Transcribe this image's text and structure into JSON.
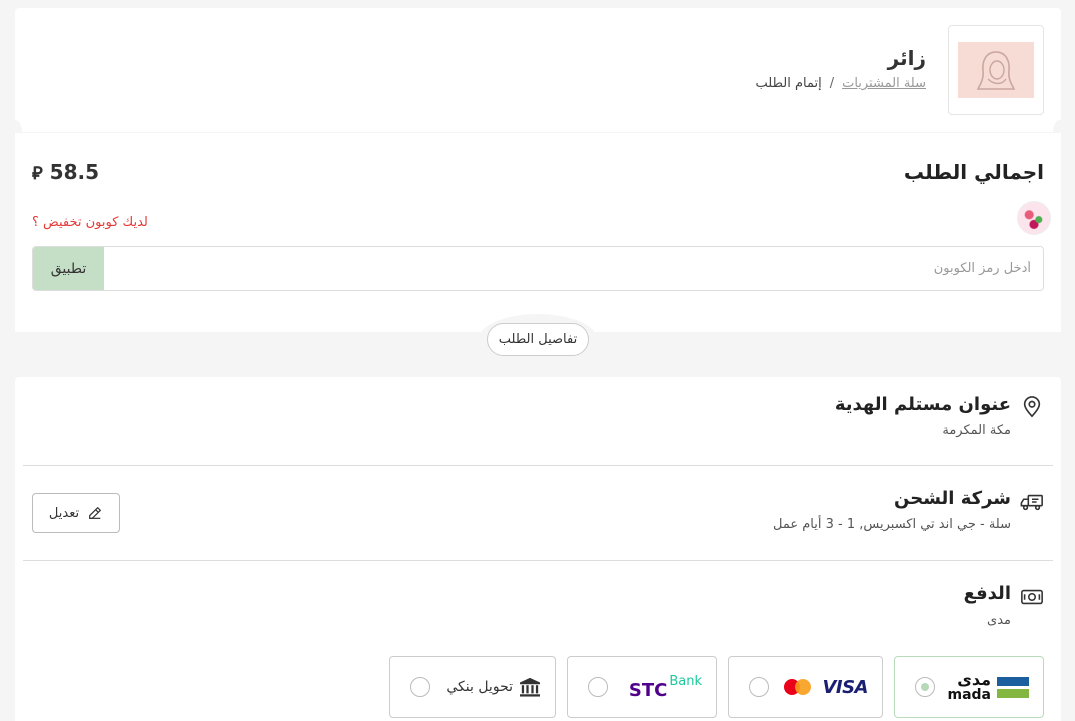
{
  "header": {
    "store_name": "زائر",
    "breadcrumb": {
      "cart_link": "سلة المشتريات",
      "separator": "/",
      "current": "إتمام الطلب"
    }
  },
  "summary": {
    "title": "اجمالي الطلب",
    "amount": "58.5",
    "currency_symbol": "⃁",
    "coupon_prompt": "لديك كوبون تخفيض ؟",
    "coupon_placeholder": "أدخل رمز الكوبون",
    "apply_label": "تطبيق",
    "details_label": "تفاصيل الطلب"
  },
  "address": {
    "title": "عنوان مستلم الهدية",
    "city": "مكة المكرمة"
  },
  "shipping": {
    "title": "شركة الشحن",
    "details": "سلة - جي اند تي اكسبريس, 1 - 3 أيام عمل",
    "edit_label": "تعديل"
  },
  "payment": {
    "title": "الدفع",
    "selected": "مدى",
    "options": [
      {
        "id": "mada",
        "ar": "مدى",
        "en": "mada",
        "selected": true
      },
      {
        "id": "visa",
        "visa": "VISA",
        "selected": false
      },
      {
        "id": "stc",
        "stc": "STC",
        "bank": "Bank",
        "selected": false
      },
      {
        "id": "bank",
        "label": "تحويل بنكي",
        "selected": false
      }
    ]
  },
  "colors": {
    "accent_green": "#c5dfc6",
    "coupon_red": "#e53935",
    "mada_blue": "#1c3c6e",
    "mada_green": "#84b740",
    "stc_purple": "#4f008c",
    "stc_green": "#1cc99b",
    "visa_navy": "#1a1f71",
    "mc_red": "#eb001b",
    "mc_orange": "#f79e1b"
  }
}
